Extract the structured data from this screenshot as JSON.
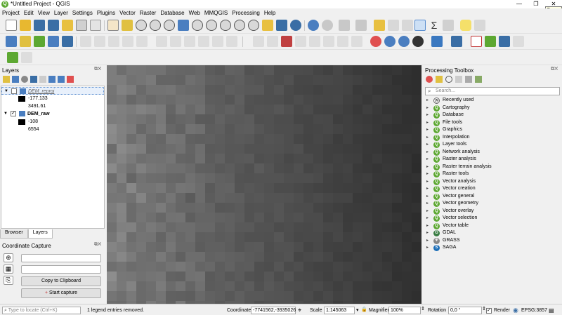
{
  "window": {
    "title": "*Untitled Project - QGIS",
    "tooltip": "Cerrar"
  },
  "menu": [
    "Project",
    "Edit",
    "View",
    "Layer",
    "Settings",
    "Plugins",
    "Vector",
    "Raster",
    "Database",
    "Web",
    "MMQGIS",
    "Processing",
    "Help"
  ],
  "layers_panel": {
    "title": "Layers",
    "layers": [
      {
        "name": "DEM_reproj",
        "checked": false,
        "min": "-177.133",
        "max": "3491.61"
      },
      {
        "name": "DEM_raw",
        "checked": true,
        "min": "-108",
        "max": "6554"
      }
    ],
    "tabs": [
      "Browser",
      "Layers"
    ]
  },
  "coordinate_capture": {
    "title": "Coordinate Capture",
    "copy_label": "Copy to Clipboard",
    "start_label": "Start capture"
  },
  "toolbox": {
    "title": "Processing Toolbox",
    "search_placeholder": "Search...",
    "items": [
      "Recently used",
      "Cartography",
      "Database",
      "File tools",
      "Graphics",
      "Interpolation",
      "Layer tools",
      "Network analysis",
      "Raster analysis",
      "Raster terrain analysis",
      "Raster tools",
      "Vector analysis",
      "Vector creation",
      "Vector general",
      "Vector geometry",
      "Vector overlay",
      "Vector selection",
      "Vector table",
      "GDAL",
      "GRASS",
      "SAGA"
    ]
  },
  "statusbar": {
    "locator_placeholder": "Type to locate (Ctrl+K)",
    "message": "1 legend entries removed.",
    "coordinate_label": "Coordinate",
    "coordinate_value": "-7741562,-3935026",
    "scale_label": "Scale",
    "scale_value": "1:145063",
    "magnifier_label": "Magnifier",
    "magnifier_value": "100%",
    "rotation_label": "Rotation",
    "rotation_value": "0,0 °",
    "render_label": "Render",
    "crs": "EPSG:3857"
  }
}
